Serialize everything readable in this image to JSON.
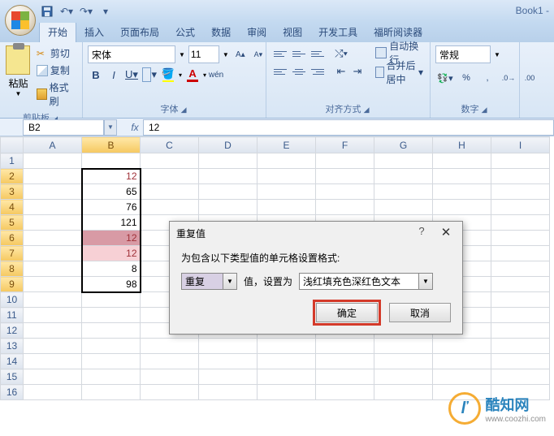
{
  "title": "Book1 -",
  "tabs": [
    "开始",
    "插入",
    "页面布局",
    "公式",
    "数据",
    "审阅",
    "视图",
    "开发工具",
    "福昕阅读器"
  ],
  "active_tab": 0,
  "ribbon": {
    "clipboard": {
      "label": "剪贴板",
      "paste": "粘贴",
      "cut": "剪切",
      "copy": "复制",
      "format_painter": "格式刷"
    },
    "font": {
      "label": "字体",
      "name": "宋体",
      "size": "11"
    },
    "align": {
      "label": "对齐方式",
      "wrap": "自动换行",
      "merge": "合并后居中"
    },
    "number": {
      "label": "数字",
      "format": "常规"
    }
  },
  "name_box": "B2",
  "formula": "12",
  "columns": [
    "A",
    "B",
    "C",
    "D",
    "E",
    "F",
    "G",
    "H",
    "I"
  ],
  "rows": 16,
  "selected_col": 1,
  "selected_rows": [
    2,
    3,
    4,
    5,
    6,
    7,
    8,
    9
  ],
  "cells": {
    "B2": {
      "v": "12",
      "cls": "dup1 active-cell"
    },
    "B3": {
      "v": "65"
    },
    "B4": {
      "v": "76"
    },
    "B5": {
      "v": "121"
    },
    "B6": {
      "v": "12",
      "cls": "dup2"
    },
    "B7": {
      "v": "12",
      "cls": "dup1"
    },
    "B8": {
      "v": "8"
    },
    "B9": {
      "v": "98"
    }
  },
  "dialog": {
    "title": "重复值",
    "label": "为包含以下类型值的单元格设置格式:",
    "type": "重复",
    "mid": "值，设置为",
    "format": "浅红填充色深红色文本",
    "ok": "确定",
    "cancel": "取消"
  },
  "watermark": {
    "main": "酷知网",
    "sub": "www.coozhi.com"
  }
}
